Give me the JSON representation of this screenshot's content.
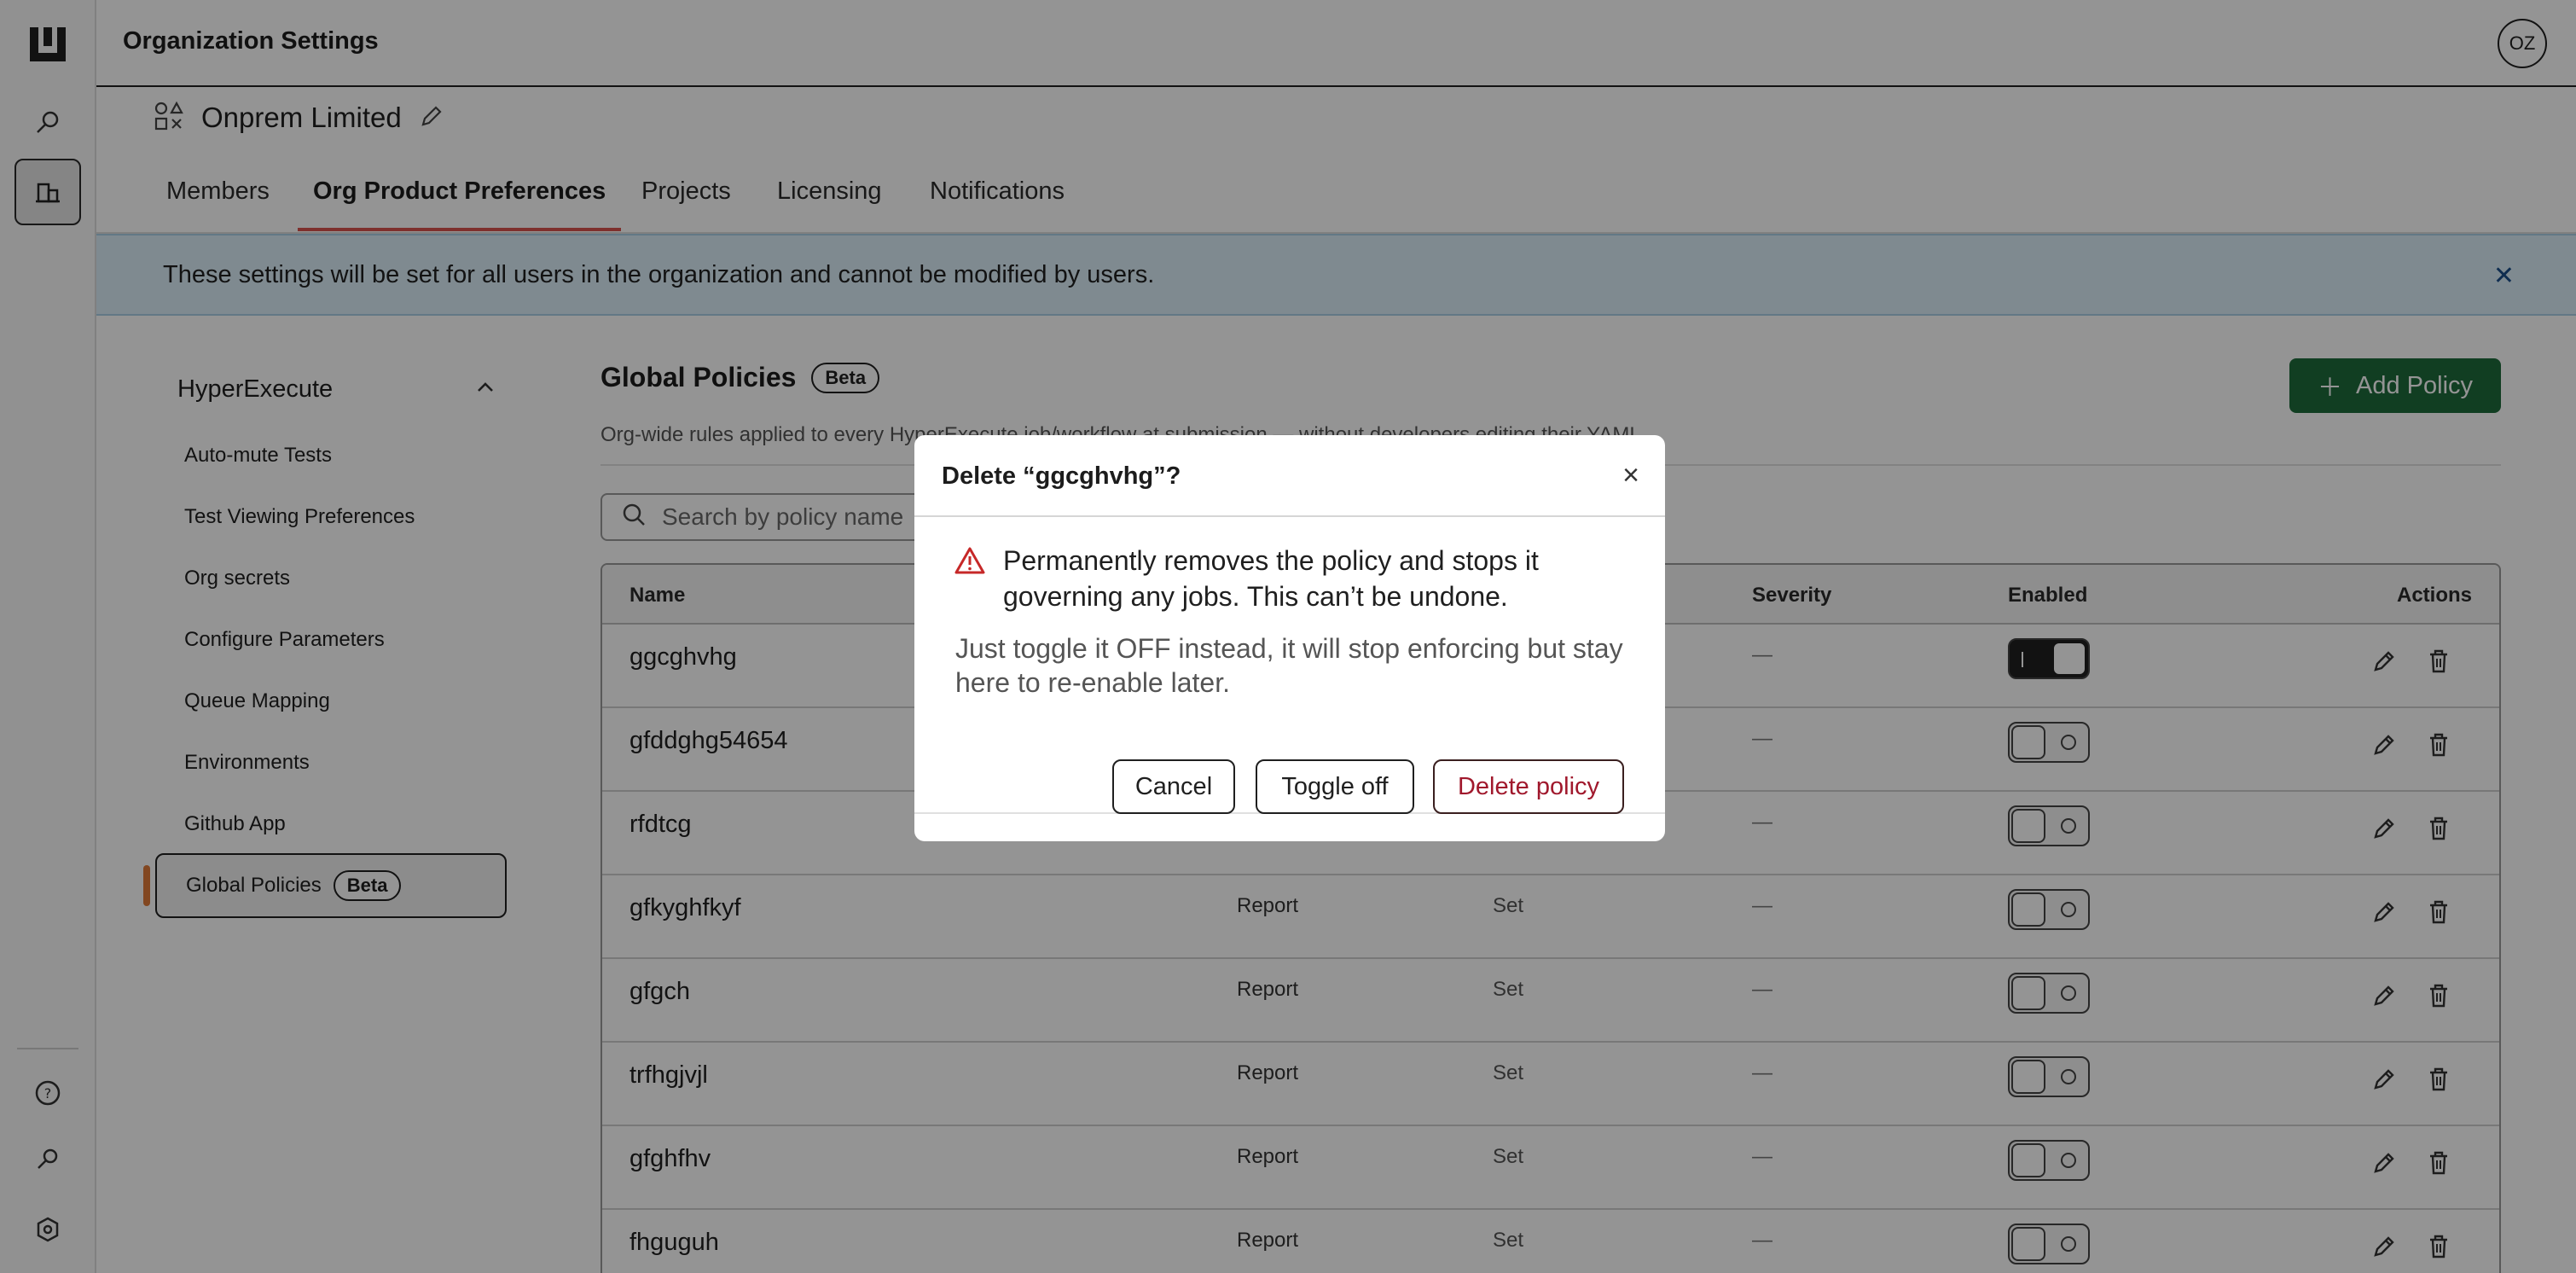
{
  "app": {
    "title": "Organization Settings",
    "avatar_initials": "OZ"
  },
  "org": {
    "name": "Onprem Limited"
  },
  "tabs": [
    {
      "label": "Members",
      "active": false
    },
    {
      "label": "Org Product Preferences",
      "active": true
    },
    {
      "label": "Projects",
      "active": false
    },
    {
      "label": "Licensing",
      "active": false
    },
    {
      "label": "Notifications",
      "active": false
    }
  ],
  "banner": {
    "text": "These settings will be set for all users in the organization and cannot be modified by users.",
    "close_icon": "close-icon"
  },
  "settings_nav": {
    "section": "HyperExecute",
    "items": [
      {
        "label": "Auto-mute Tests"
      },
      {
        "label": "Test Viewing Preferences"
      },
      {
        "label": "Org secrets"
      },
      {
        "label": "Configure Parameters"
      },
      {
        "label": "Queue Mapping"
      },
      {
        "label": "Environments"
      },
      {
        "label": "Github App"
      },
      {
        "label": "Global Policies",
        "badge": "Beta",
        "active": true
      }
    ]
  },
  "main": {
    "title": "Global Policies",
    "badge": "Beta",
    "subtitle": "Org-wide rules applied to every HyperExecute job/workflow at submission — without developers editing their YAML.",
    "add_button": "Add Policy",
    "search_placeholder": "Search by policy name",
    "columns": [
      "Name",
      "Severity",
      "Enabled",
      "Actions"
    ],
    "rows": [
      {
        "name": "ggcghvhg",
        "mode": "",
        "scope": "",
        "severity": "—",
        "enabled": true
      },
      {
        "name": "gfddghg54654",
        "mode": "",
        "scope": "",
        "severity": "—",
        "enabled": false
      },
      {
        "name": "rfdtcg",
        "mode": "",
        "scope": "",
        "severity": "—",
        "enabled": false
      },
      {
        "name": "gfkyghfkyf",
        "mode": "Report",
        "scope": "Set",
        "severity": "—",
        "enabled": false
      },
      {
        "name": "gfgch",
        "mode": "Report",
        "scope": "Set",
        "severity": "—",
        "enabled": false
      },
      {
        "name": "trfhgjvjl",
        "mode": "Report",
        "scope": "Set",
        "severity": "—",
        "enabled": false
      },
      {
        "name": "gfghfhv",
        "mode": "Report",
        "scope": "Set",
        "severity": "—",
        "enabled": false
      },
      {
        "name": "fhguguh",
        "mode": "Report",
        "scope": "Set",
        "severity": "—",
        "enabled": false
      }
    ]
  },
  "modal": {
    "title": "Delete “ggcghvhg”?",
    "warning": "Permanently removes the policy and stops it governing any jobs. This can’t be undone.",
    "hint": "Just toggle it OFF instead, it will stop enforcing but stay here to re-enable later.",
    "buttons": {
      "cancel": "Cancel",
      "toggle_off": "Toggle off",
      "delete": "Delete policy"
    },
    "colors": {
      "danger": "#a0182c",
      "warning_icon": "#c62828"
    }
  }
}
